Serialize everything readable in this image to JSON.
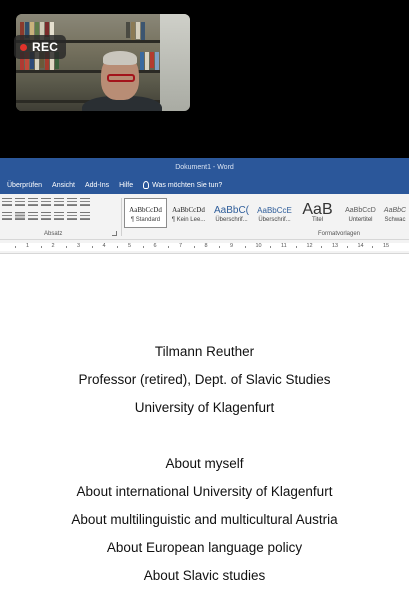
{
  "recording": {
    "label": "REC"
  },
  "window": {
    "title": "Dokument1  -  Word"
  },
  "menu": {
    "items": [
      "Überprüfen",
      "Ansicht",
      "Add-Ins",
      "Hilfe"
    ],
    "search_placeholder": "Was möchten Sie tun?"
  },
  "ribbon": {
    "paragraph_group_label": "Absatz",
    "styles_group_label": "Formatvorlagen",
    "styles": [
      {
        "sample": "AaBbCcDd",
        "name": "¶ Standard"
      },
      {
        "sample": "AaBbCcDd",
        "name": "¶ Kein Lee..."
      },
      {
        "sample": "AaBbC(",
        "name": "Überschrif..."
      },
      {
        "sample": "AaBbCcE",
        "name": "Überschrif..."
      },
      {
        "sample": "AaB",
        "name": "Titel"
      },
      {
        "sample": "AaBbCcD",
        "name": "Untertitel"
      },
      {
        "sample": "AaBbC",
        "name": "Schwac"
      }
    ]
  },
  "ruler": {
    "numbers": [
      "1",
      "2",
      "3",
      "4",
      "5",
      "6",
      "7",
      "8",
      "9",
      "10",
      "11",
      "12",
      "13",
      "14",
      "15"
    ]
  },
  "document": {
    "lines": [
      "Tilmann Reuther",
      "Professor (retired), Dept. of Slavic Studies",
      "University of Klagenfurt",
      "About myself",
      "About international University of Klagenfurt",
      "About multilinguistic and multicultural Austria",
      "About European language policy",
      "About Slavic studies"
    ]
  }
}
